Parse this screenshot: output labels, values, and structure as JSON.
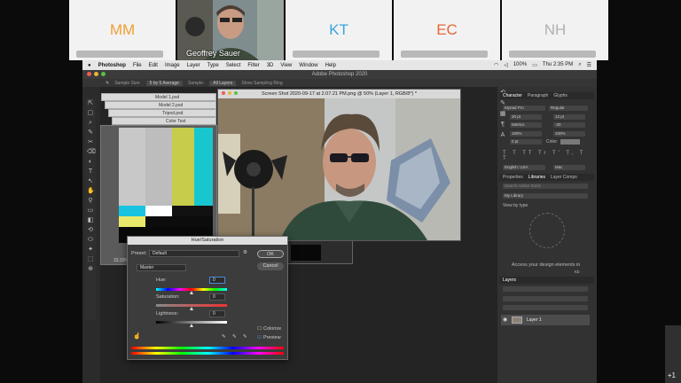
{
  "participants": [
    {
      "initials": "MM",
      "color": "#f0a030"
    },
    {
      "name": "Geoffrey Sauer"
    },
    {
      "initials": "KT",
      "color": "#3aa5d8"
    },
    {
      "initials": "EC",
      "color": "#e8663a"
    },
    {
      "initials": "NH",
      "color": "#b0b0b0"
    }
  ],
  "menubar": {
    "apple": "",
    "app": "Photoshop",
    "items": [
      "File",
      "Edit",
      "Image",
      "Layer",
      "Type",
      "Select",
      "Filter",
      "3D",
      "View",
      "Window",
      "Help"
    ],
    "battery": "100%",
    "clock": "Thu 2:35 PM"
  },
  "photoshop": {
    "window_title": "Adobe Photoshop 2020",
    "options": {
      "sample_size_label": "Sample Size:",
      "sample_size": "5 by 5 Average",
      "sample_label": "Sample:",
      "sample": "All Layers",
      "show_ring": "Show Sampling Ring"
    },
    "stack_windows": [
      "Model 1.psd",
      "Model 2.psd",
      "Tripod.psd",
      "Color Test"
    ],
    "zoom": "33.33%",
    "document_title": "Screen Shot 2020-09-17 at 2.07.21 PM.png @ 50% (Layer 1, RGB/8*) *",
    "tools": [
      "⇱",
      "▢",
      "⌕",
      "✎",
      "✂",
      "⌫",
      "◐",
      "T",
      "↖",
      "✋",
      "⚲",
      "▭",
      "◧",
      "⟲",
      "⬭",
      "✦",
      "⬚",
      "⊕"
    ]
  },
  "panels": {
    "character_tabs": [
      "Character",
      "Paragraph",
      "Glyphs"
    ],
    "font_family": "Myriad Pro",
    "font_style": "Regular",
    "font_size": "20 pt",
    "leading": "12 pt",
    "kerning": "Metrics",
    "tracking": "-20",
    "scale_v": "100%",
    "scale_h": "100%",
    "baseline": "0 pt",
    "color_label": "Color:",
    "language": "English: USA",
    "aa": "Mac",
    "libraries_tabs": [
      "Properties",
      "Libraries",
      "Layer Comps"
    ],
    "search_placeholder": "Search Adobe Stock",
    "library": "My Library",
    "view_by": "View by type",
    "access_text": "Access your design elements in",
    "size": "Kb",
    "layers_title": "Layers",
    "layer_name": "Layer 1"
  },
  "dialog": {
    "title": "Hue/Saturation",
    "preset_label": "Preset:",
    "preset": "Default",
    "ok": "OK",
    "cancel": "Cancel",
    "channel": "Master",
    "hue_label": "Hue:",
    "hue_value": "0",
    "saturation_label": "Saturation:",
    "saturation_value": "0",
    "lightness_label": "Lightness:",
    "lightness_value": "0",
    "colorize": "Colorize",
    "preview": "Preview"
  },
  "overflow_count": "+1"
}
